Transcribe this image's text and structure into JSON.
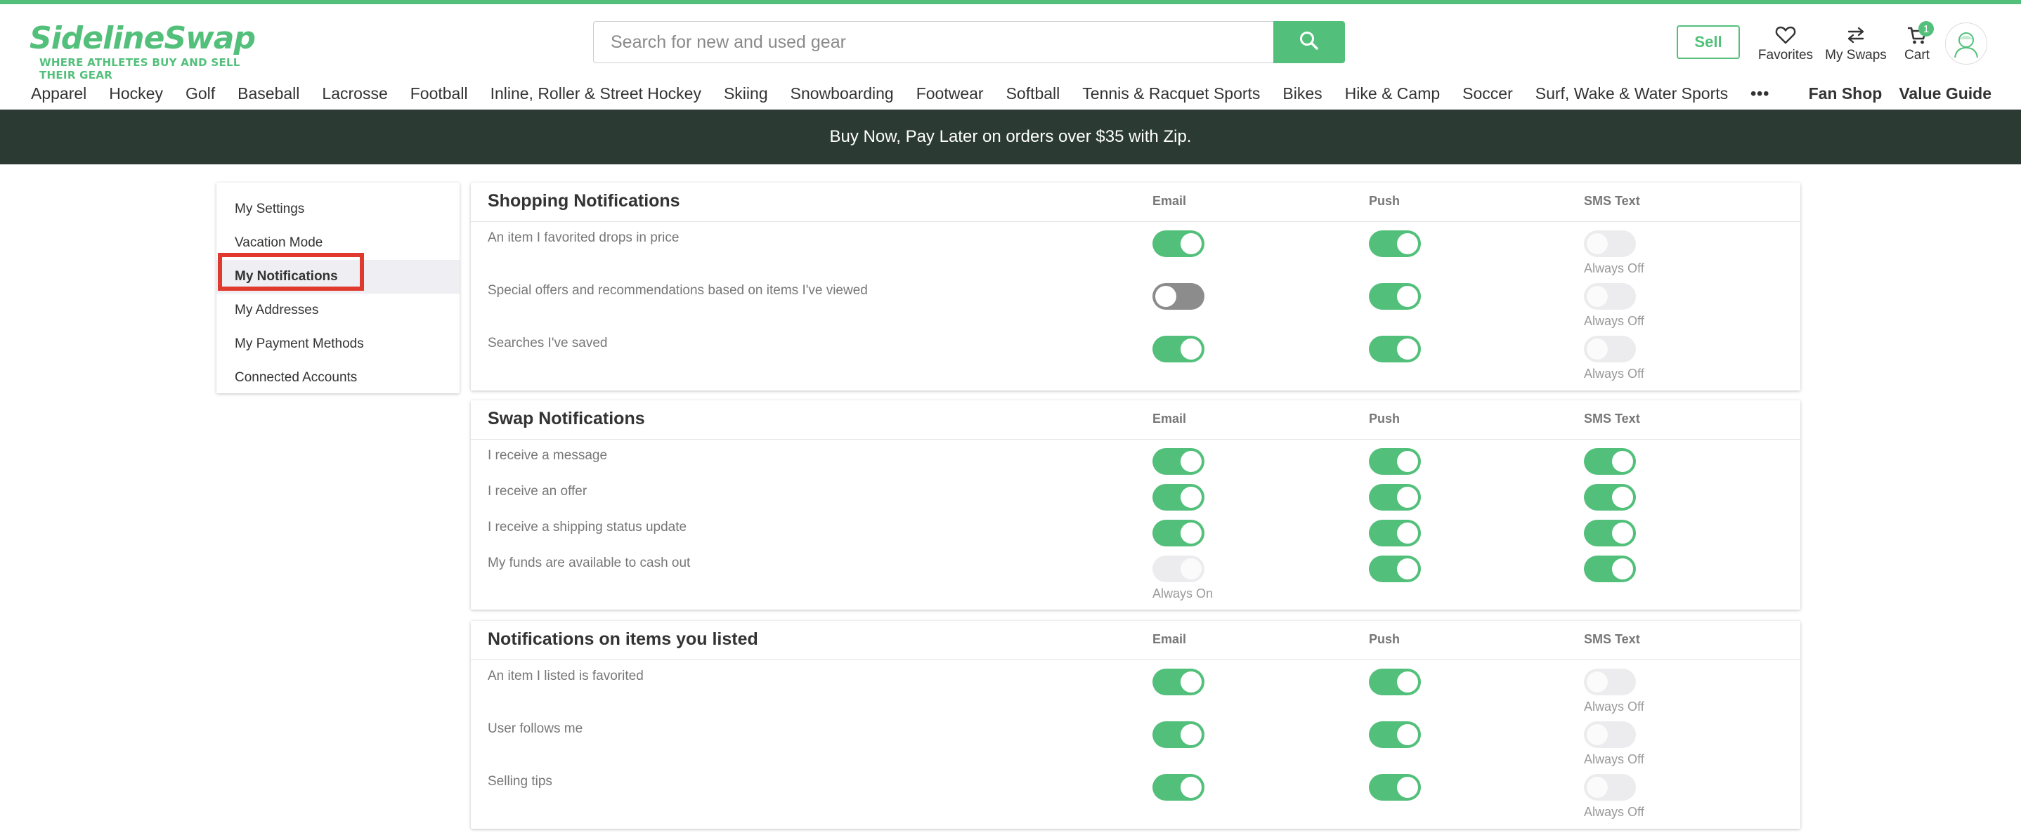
{
  "header": {
    "logo_main": "SidelineSwap",
    "logo_tagline": "WHERE ATHLETES BUY AND SELL THEIR GEAR",
    "search_placeholder": "Search for new and used gear",
    "sell_label": "Sell",
    "favorites_label": "Favorites",
    "swaps_label": "My Swaps",
    "cart_label": "Cart",
    "cart_count": "1"
  },
  "categories": [
    "Apparel",
    "Hockey",
    "Golf",
    "Baseball",
    "Lacrosse",
    "Football",
    "Inline, Roller & Street Hockey",
    "Skiing",
    "Snowboarding",
    "Footwear",
    "Softball",
    "Tennis & Racquet Sports",
    "Bikes",
    "Hike & Camp",
    "Soccer",
    "Surf, Wake & Water Sports"
  ],
  "more_label": "•••",
  "nav_right": {
    "fan_shop": "Fan Shop",
    "value_guide": "Value Guide"
  },
  "promo": "Buy Now, Pay Later on orders over $35 with Zip.",
  "sidebar": {
    "items": [
      "My Settings",
      "Vacation Mode",
      "My Notifications",
      "My Addresses",
      "My Payment Methods",
      "Connected Accounts"
    ],
    "active": "My Notifications"
  },
  "columns": {
    "email": "Email",
    "push": "Push",
    "sms": "SMS Text"
  },
  "sections": [
    {
      "title": "Shopping Notifications",
      "rows": [
        {
          "label": "An item I favorited drops in price",
          "email": "on",
          "push": "on",
          "sms": "disabled",
          "sms_note": "Always Off"
        },
        {
          "label": "Special offers and recommendations based on items I've viewed",
          "email": "off",
          "push": "on",
          "sms": "disabled",
          "sms_note": "Always Off"
        },
        {
          "label": "Searches I've saved",
          "email": "on",
          "push": "on",
          "sms": "disabled",
          "sms_note": "Always Off"
        }
      ]
    },
    {
      "title": "Swap Notifications",
      "rows": [
        {
          "label": "I receive a message",
          "email": "on",
          "push": "on",
          "sms": "on"
        },
        {
          "label": "I receive an offer",
          "email": "on",
          "push": "on",
          "sms": "on"
        },
        {
          "label": "I receive a shipping status update",
          "email": "on",
          "push": "on",
          "sms": "on"
        },
        {
          "label": "My funds are available to cash out",
          "email": "disabled-on",
          "email_note": "Always On",
          "push": "on",
          "sms": "on"
        }
      ]
    },
    {
      "title": "Notifications on items you listed",
      "rows": [
        {
          "label": "An item I listed is favorited",
          "email": "on",
          "push": "on",
          "sms": "disabled",
          "sms_note": "Always Off"
        },
        {
          "label": "User follows me",
          "email": "on",
          "push": "on",
          "sms": "disabled",
          "sms_note": "Always Off"
        },
        {
          "label": "Selling tips",
          "email": "on",
          "push": "on",
          "sms": "disabled",
          "sms_note": "Always Off"
        }
      ]
    }
  ],
  "colors": {
    "brand_green": "#52c07a",
    "banner_dark": "#2b3a33",
    "highlight_red": "#e03a2e"
  }
}
